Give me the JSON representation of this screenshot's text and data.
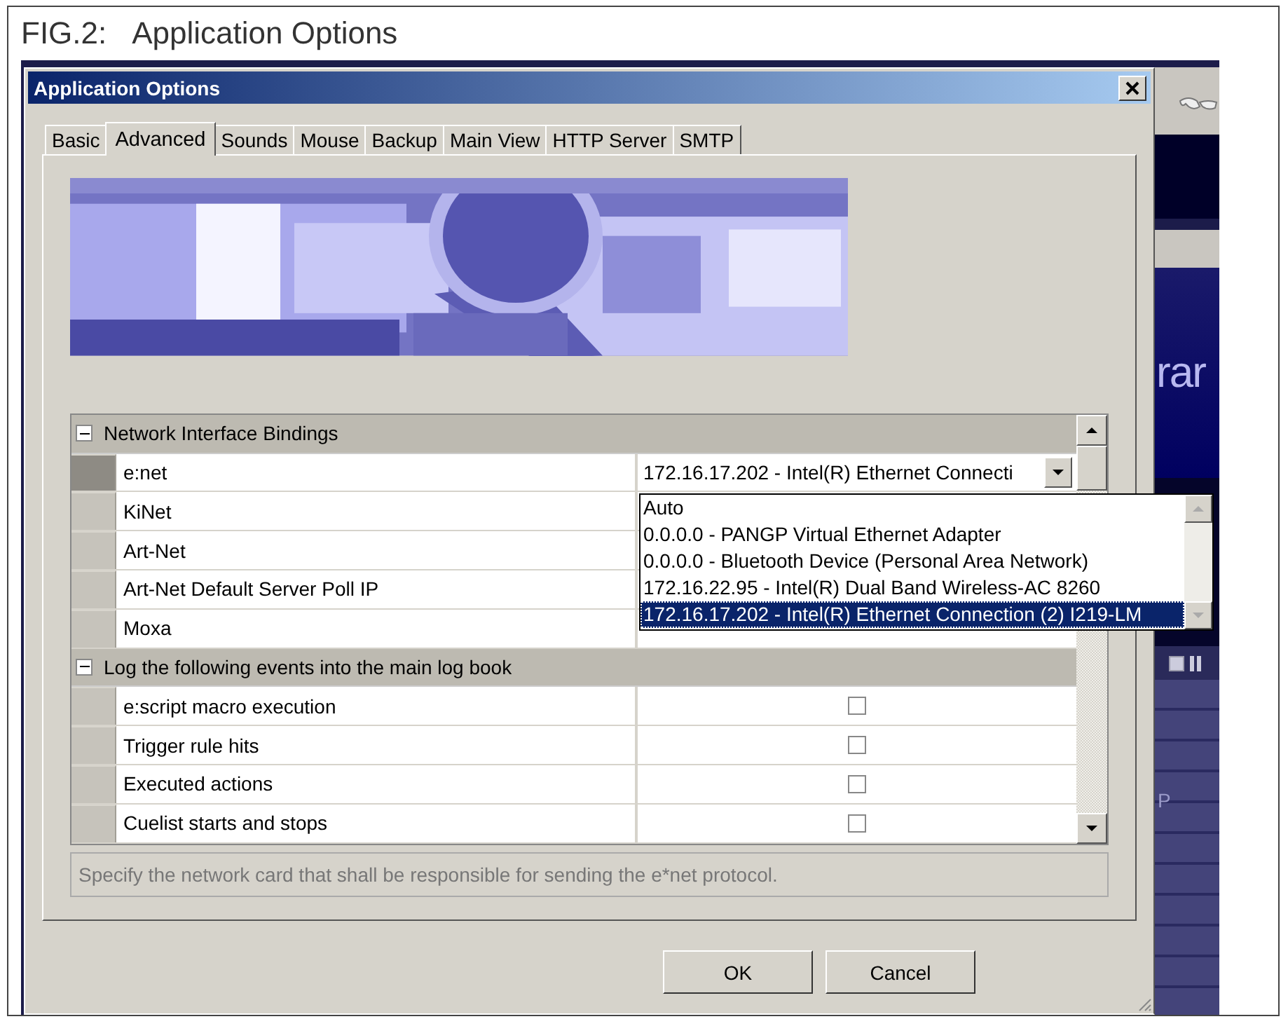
{
  "caption": {
    "label": "FIG.2:",
    "title": "Application Options"
  },
  "dialog": {
    "title": "Application Options",
    "tabs": [
      {
        "label": "Basic",
        "selected": false
      },
      {
        "label": "Advanced",
        "selected": true
      },
      {
        "label": "Sounds",
        "selected": false
      },
      {
        "label": "Mouse",
        "selected": false
      },
      {
        "label": "Backup",
        "selected": false
      },
      {
        "label": "Main View",
        "selected": false
      },
      {
        "label": "HTTP Server",
        "selected": false
      },
      {
        "label": "SMTP",
        "selected": false
      }
    ],
    "grid": {
      "sections": [
        {
          "title": "Network Interface Bindings",
          "expanded": true,
          "rows": [
            {
              "name": "e:net",
              "kind": "dropdown",
              "value": "172.16.17.202 - Intel(R) Ethernet Connecti",
              "selected": true
            },
            {
              "name": "KiNet",
              "kind": "text",
              "selected": false
            },
            {
              "name": "Art-Net",
              "kind": "text",
              "selected": false
            },
            {
              "name": "Art-Net Default Server Poll IP",
              "kind": "text",
              "selected": false
            },
            {
              "name": "Moxa",
              "kind": "text",
              "selected": false
            }
          ]
        },
        {
          "title": "Log the following events into the main log book",
          "expanded": true,
          "rows": [
            {
              "name": "e:script macro execution",
              "kind": "checkbox",
              "checked": false,
              "selected": false
            },
            {
              "name": "Trigger rule hits",
              "kind": "checkbox",
              "checked": false,
              "selected": false
            },
            {
              "name": "Executed actions",
              "kind": "checkbox",
              "checked": false,
              "selected": false
            },
            {
              "name": "Cuelist starts and stops",
              "kind": "checkbox",
              "checked": false,
              "selected": false
            }
          ]
        }
      ]
    },
    "dropdown": {
      "items": [
        {
          "label": "Auto",
          "selected": false
        },
        {
          "label": "0.0.0.0 - PANGP Virtual Ethernet Adapter",
          "selected": false
        },
        {
          "label": "0.0.0.0 - Bluetooth Device (Personal Area Network)",
          "selected": false
        },
        {
          "label": "172.16.22.95 - Intel(R) Dual Band Wireless-AC 8260",
          "selected": false
        },
        {
          "label": "172.16.17.202 - Intel(R) Ethernet Connection (2) I219-LM",
          "selected": true
        }
      ]
    },
    "help": "Specify the network card that shall be responsible for sending the e*net protocol.",
    "buttons": [
      "OK",
      "Cancel"
    ]
  },
  "background_window": {
    "texts": [
      "rar",
      "P"
    ]
  }
}
